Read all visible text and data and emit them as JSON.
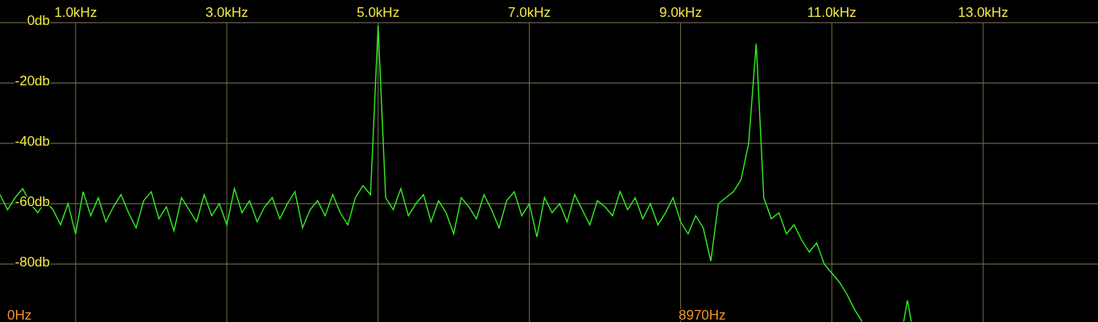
{
  "spectrum": {
    "range_start": "0Hz",
    "cursor_readout": "8970Hz",
    "chart_data": {
      "type": "line",
      "grid": true,
      "xlim": [
        0,
        14.52
      ],
      "ylim": [
        -99.2,
        7.5
      ],
      "xticks": [
        {
          "value": 1,
          "label": "1.0kHz"
        },
        {
          "value": 3,
          "label": "3.0kHz"
        },
        {
          "value": 5,
          "label": "5.0kHz"
        },
        {
          "value": 7,
          "label": "7.0kHz"
        },
        {
          "value": 9,
          "label": "9.0kHz"
        },
        {
          "value": 11,
          "label": "11.0kHz"
        },
        {
          "value": 13,
          "label": "13.0kHz"
        }
      ],
      "yticks": [
        {
          "value": 0,
          "label": "0db"
        },
        {
          "value": -20,
          "label": "-20db"
        },
        {
          "value": -40,
          "label": "-40db"
        },
        {
          "value": -60,
          "label": "-60db"
        },
        {
          "value": -80,
          "label": "-80db"
        }
      ],
      "x": [
        0,
        0.1,
        0.2,
        0.3,
        0.4,
        0.5,
        0.6,
        0.7,
        0.8,
        0.9,
        1,
        1.1,
        1.2,
        1.3,
        1.4,
        1.5,
        1.6,
        1.7,
        1.8,
        1.9,
        2,
        2.1,
        2.2,
        2.3,
        2.4,
        2.5,
        2.6,
        2.7,
        2.8,
        2.9,
        3,
        3.1,
        3.2,
        3.3,
        3.4,
        3.5,
        3.6,
        3.7,
        3.8,
        3.9,
        4,
        4.1,
        4.2,
        4.3,
        4.4,
        4.5,
        4.6,
        4.7,
        4.8,
        4.9,
        5,
        5.1,
        5.2,
        5.3,
        5.4,
        5.5,
        5.6,
        5.7,
        5.8,
        5.9,
        6,
        6.1,
        6.2,
        6.3,
        6.4,
        6.5,
        6.6,
        6.7,
        6.8,
        6.9,
        7,
        7.1,
        7.2,
        7.3,
        7.4,
        7.5,
        7.6,
        7.7,
        7.8,
        7.9,
        8,
        8.1,
        8.2,
        8.3,
        8.4,
        8.5,
        8.6,
        8.7,
        8.8,
        8.9,
        9,
        9.1,
        9.2,
        9.3,
        9.4,
        9.5,
        9.6,
        9.7,
        9.8,
        9.9,
        10,
        10.1,
        10.2,
        10.3,
        10.4,
        10.5,
        10.6,
        10.7,
        10.8,
        10.9,
        11,
        11.1,
        11.2,
        11.3,
        11.4,
        11.5,
        11.95,
        12,
        12.05
      ],
      "series": [
        {
          "color": "#33ee22",
          "values": [
            -57,
            -62,
            -58,
            -55,
            -60,
            -63,
            -59,
            -62,
            -67,
            -60,
            -70,
            -56,
            -64,
            -58,
            -66,
            -61,
            -57,
            -63,
            -68,
            -59,
            -56,
            -65,
            -61,
            -69,
            -58,
            -62,
            -66,
            -57,
            -64,
            -60,
            -67,
            -55,
            -63,
            -59,
            -66,
            -61,
            -58,
            -65,
            -60,
            -56,
            -68,
            -62,
            -59,
            -64,
            -57,
            -63,
            -67,
            -58,
            -54,
            -57,
            -1,
            -58,
            -62,
            -55,
            -64,
            -60,
            -57,
            -66,
            -59,
            -63,
            -70,
            -58,
            -61,
            -65,
            -57,
            -62,
            -68,
            -59,
            -56,
            -64,
            -60,
            -71,
            -58,
            -63,
            -60,
            -66,
            -57,
            -62,
            -67,
            -59,
            -61,
            -64,
            -56,
            -62,
            -58,
            -65,
            -60,
            -67,
            -63,
            -58,
            -66,
            -70,
            -64,
            -68,
            -79,
            -60,
            -58,
            -56,
            -52,
            -40,
            -7,
            -58,
            -65,
            -63,
            -70,
            -67,
            -72,
            -76,
            -73,
            -80,
            -83,
            -86,
            -90,
            -95,
            -99,
            null,
            -99,
            -92,
            -99
          ]
        }
      ]
    }
  }
}
